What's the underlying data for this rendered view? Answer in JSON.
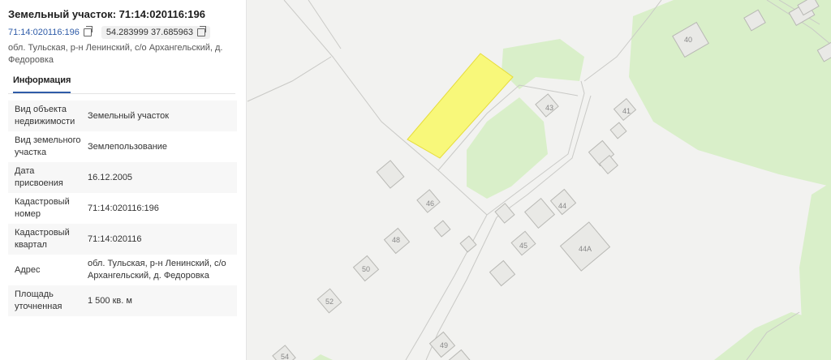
{
  "panel": {
    "title": "Земельный участок: 71:14:020116:196",
    "cad_link": "71:14:020116:196",
    "coordinates": "54.283999 37.685963",
    "address": "обл. Тульская, р-н Ленинский, с/о Архангельский, д. Федоровка",
    "tab_label": "Информация",
    "rows": [
      {
        "label": "Вид объекта недвижимости",
        "value": "Земельный участок"
      },
      {
        "label": "Вид земельного участка",
        "value": "Землепользование"
      },
      {
        "label": "Дата присвоения",
        "value": "16.12.2005"
      },
      {
        "label": "Кадастровый номер",
        "value": "71:14:020116:196"
      },
      {
        "label": "Кадастровый квартал",
        "value": "71:14:020116"
      },
      {
        "label": "Адрес",
        "value": "обл. Тульская, р-н Ленинский, с/о Архангельский, д. Федоровка"
      },
      {
        "label": "Площадь уточненная",
        "value": "1 500 кв. м"
      }
    ]
  },
  "map": {
    "house_numbers": {
      "n40": "40",
      "n41": "41",
      "n43": "43",
      "n44": "44",
      "n44a": "44А",
      "n45": "45",
      "n46": "46",
      "n48": "48",
      "n49": "49",
      "n50": "50",
      "n52": "52",
      "n54": "54"
    },
    "colors": {
      "parcel_fill": "#f8f87a",
      "parcel_stroke": "#e6dc3a",
      "green": "#d9efc9",
      "building": "#e9e9e6"
    }
  }
}
